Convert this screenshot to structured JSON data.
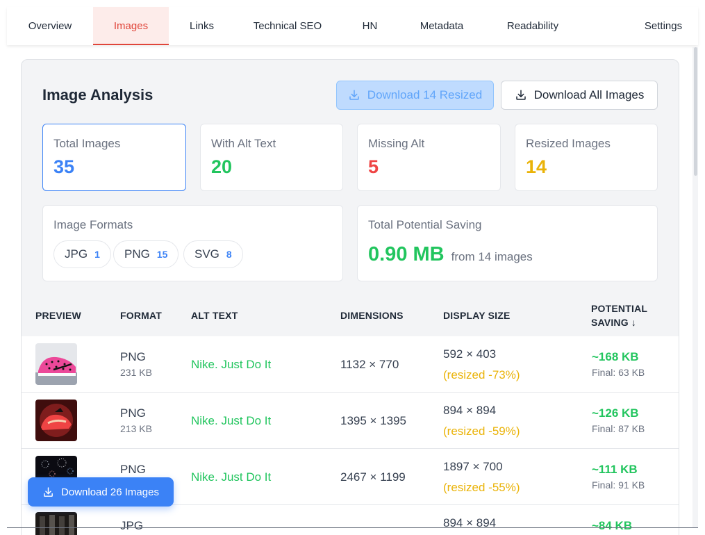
{
  "nav": {
    "tabs": [
      "Overview",
      "Images",
      "Links",
      "Technical SEO",
      "HN",
      "Metadata",
      "Readability",
      "Settings"
    ],
    "active": "Images"
  },
  "panel": {
    "title": "Image Analysis",
    "download_resized": "Download 14 Resized",
    "download_all": "Download All Images"
  },
  "stats": {
    "total": {
      "label": "Total Images",
      "value": "35",
      "color": "#3b82f6"
    },
    "with_alt": {
      "label": "With Alt Text",
      "value": "20",
      "color": "#22c55e"
    },
    "missing": {
      "label": "Missing Alt",
      "value": "5",
      "color": "#ef4444"
    },
    "resized": {
      "label": "Resized Images",
      "value": "14",
      "color": "#eab308"
    }
  },
  "formats": {
    "label": "Image Formats",
    "items": [
      {
        "name": "JPG",
        "count": "1"
      },
      {
        "name": "PNG",
        "count": "15"
      },
      {
        "name": "SVG",
        "count": "8"
      }
    ]
  },
  "saving": {
    "label": "Total Potential Saving",
    "value": "0.90 MB",
    "suffix": "from 14 images"
  },
  "table": {
    "headers": {
      "preview": "PREVIEW",
      "format": "FORMAT",
      "alt": "ALT TEXT",
      "dimensions": "DIMENSIONS",
      "display": "DISPLAY SIZE",
      "saving_1": "POTENTIAL",
      "saving_2": "SAVING ↓"
    },
    "rows": [
      {
        "format": "PNG",
        "size": "231 KB",
        "alt": "Nike. Just Do It",
        "dimensions": "1132 × 770",
        "display": "592 × 403",
        "resized": "(resized -73%)",
        "saving": "~168 KB",
        "final": "Final: 63 KB"
      },
      {
        "format": "PNG",
        "size": "213 KB",
        "alt": "Nike. Just Do It",
        "dimensions": "1395 × 1395",
        "display": "894 × 894",
        "resized": "(resized -59%)",
        "saving": "~126 KB",
        "final": "Final: 87 KB"
      },
      {
        "format": "PNG",
        "size": "",
        "alt": "Nike. Just Do It",
        "dimensions": "2467 × 1199",
        "display": "1897 × 700",
        "resized": "(resized -55%)",
        "saving": "~111 KB",
        "final": "Final: 91 KB"
      },
      {
        "format": "JPG",
        "size": "",
        "alt": "",
        "dimensions": "",
        "display": "894 × 894",
        "resized": "",
        "saving": "~84 KB",
        "final": ""
      }
    ]
  },
  "floating": {
    "label": "Download 26 Images"
  }
}
